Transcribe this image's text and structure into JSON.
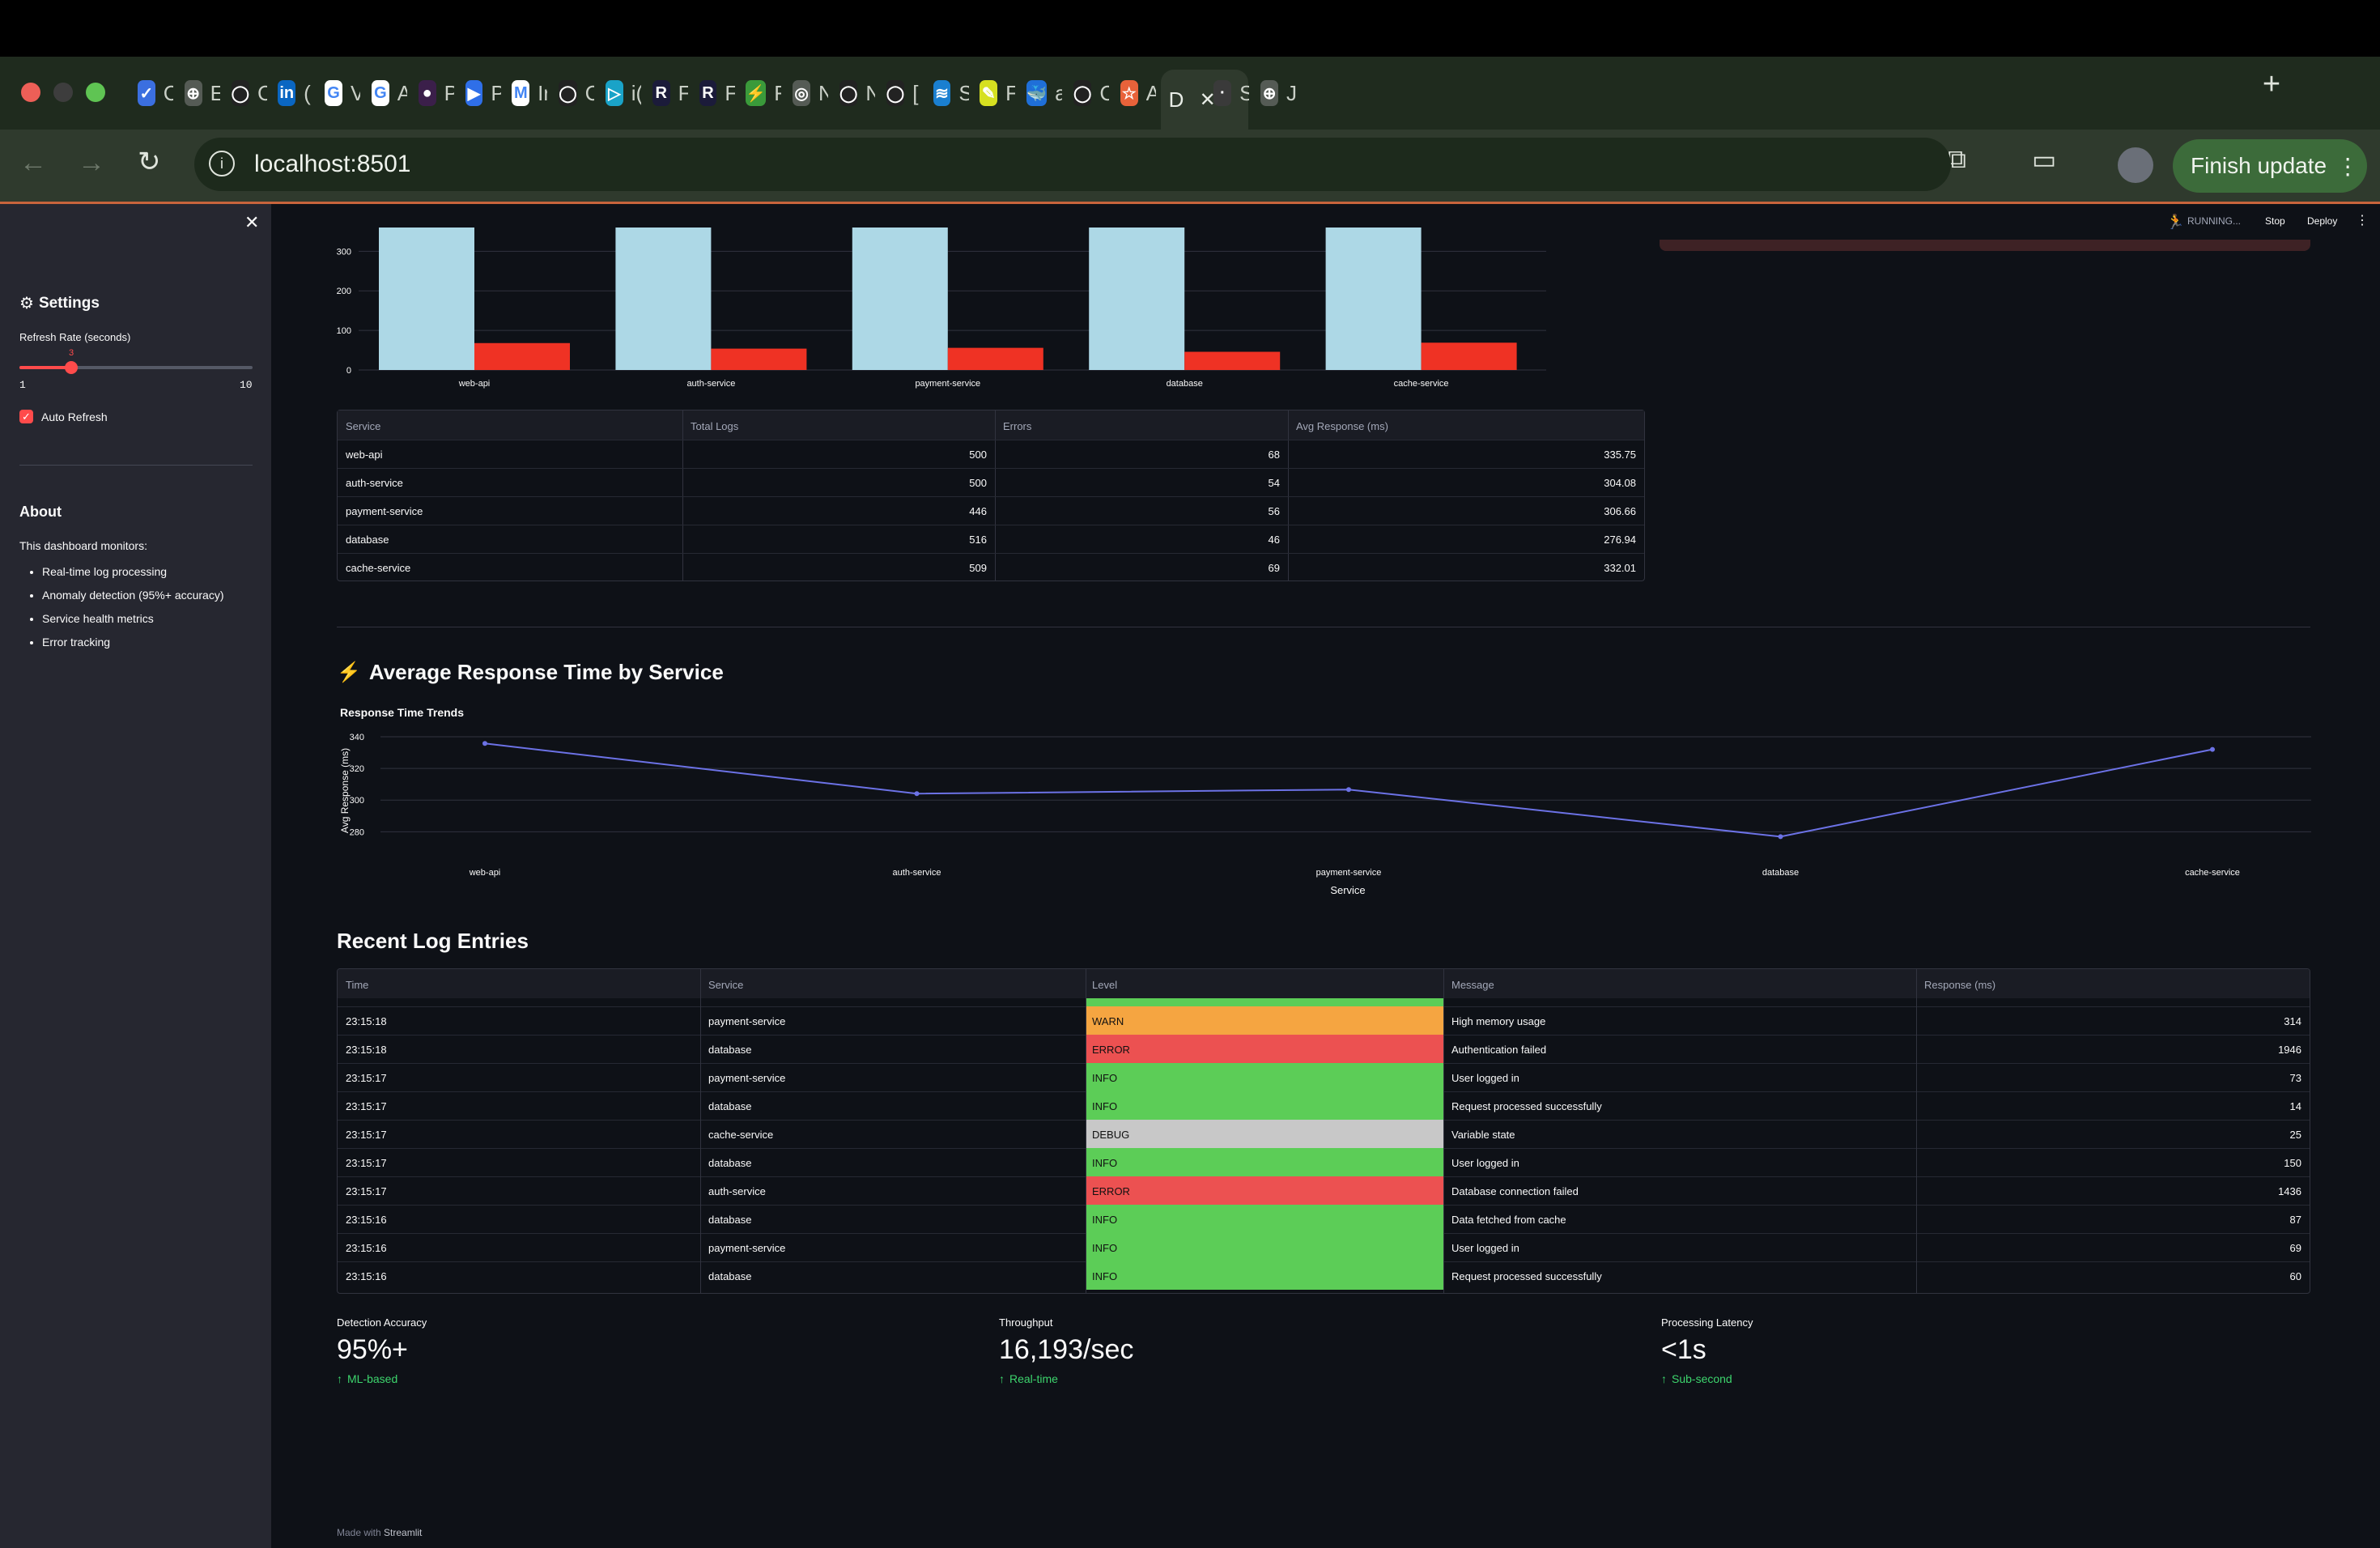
{
  "browser": {
    "tabs": [
      {
        "letter": "C",
        "color": "#3b6fe0",
        "glyph": "✓"
      },
      {
        "letter": "E",
        "color": "#555b55",
        "glyph": "⊕"
      },
      {
        "letter": "C",
        "color": "#222",
        "glyph": "◯"
      },
      {
        "letter": "(",
        "color": "#0a66c2",
        "glyph": "in"
      },
      {
        "letter": "V",
        "color": "#fff",
        "glyph": "G"
      },
      {
        "letter": "A",
        "color": "#fff",
        "glyph": "G"
      },
      {
        "letter": "P",
        "color": "#3b1f4a",
        "glyph": "●"
      },
      {
        "letter": "P",
        "color": "#2f6fe8",
        "glyph": "▶"
      },
      {
        "letter": "Ir",
        "color": "#fff",
        "glyph": "M"
      },
      {
        "letter": "C",
        "color": "#222",
        "glyph": "◯"
      },
      {
        "letter": "i(",
        "color": "#1aa3c8",
        "glyph": "▷"
      },
      {
        "letter": "F",
        "color": "#1b1b3a",
        "glyph": "R"
      },
      {
        "letter": "F",
        "color": "#1b1b3a",
        "glyph": "R"
      },
      {
        "letter": "F",
        "color": "#3a9a3a",
        "glyph": "⚡"
      },
      {
        "letter": "N",
        "color": "#555b55",
        "glyph": "◎"
      },
      {
        "letter": "N",
        "color": "#222",
        "glyph": "◯"
      },
      {
        "letter": "[",
        "color": "#222",
        "glyph": "◯"
      },
      {
        "letter": "S",
        "color": "#1a7fd0",
        "glyph": "≋"
      },
      {
        "letter": "F",
        "color": "#d6e020",
        "glyph": "✎"
      },
      {
        "letter": "a",
        "color": "#1f6fd8",
        "glyph": "🐳"
      },
      {
        "letter": "C",
        "color": "#222",
        "glyph": "◯"
      },
      {
        "letter": "A",
        "color": "#e8623a",
        "glyph": "☆"
      },
      {
        "letter": "D",
        "color": "#2f3a2d",
        "glyph": ""
      },
      {
        "letter": "S",
        "color": "#3a3a3a",
        "glyph": "·"
      },
      {
        "letter": "J",
        "color": "#555b55",
        "glyph": "⊕"
      }
    ],
    "url": "localhost:8501",
    "finish_update": "Finish update"
  },
  "app_header": {
    "status": "RUNNING...",
    "stop": "Stop",
    "deploy": "Deploy"
  },
  "sidebar": {
    "settings_title": "Settings",
    "refresh_label": "Refresh Rate (seconds)",
    "slider_value": "3",
    "slider_min": "1",
    "slider_max": "10",
    "slider_fraction": 0.2222,
    "auto_refresh": "Auto Refresh",
    "about_title": "About",
    "about_intro": "This dashboard monitors:",
    "about_items": [
      "Real-time log processing",
      "Anomaly detection (95%+ accuracy)",
      "Service health metrics",
      "Error tracking"
    ]
  },
  "service_table": {
    "headers": [
      "Service",
      "Total Logs",
      "Errors",
      "Avg Response (ms)"
    ],
    "rows": [
      [
        "web-api",
        "500",
        "68",
        "335.75"
      ],
      [
        "auth-service",
        "500",
        "54",
        "304.08"
      ],
      [
        "payment-service",
        "446",
        "56",
        "306.66"
      ],
      [
        "database",
        "516",
        "46",
        "276.94"
      ],
      [
        "cache-service",
        "509",
        "69",
        "332.01"
      ]
    ]
  },
  "response_section": {
    "icon": "⚡",
    "title": "Average Response Time by Service"
  },
  "chart_data": [
    {
      "type": "bar",
      "categories": [
        "web-api",
        "auth-service",
        "payment-service",
        "database",
        "cache-service"
      ],
      "series": [
        {
          "values": [
            500,
            500,
            446,
            516,
            509
          ],
          "color": "#add8e6"
        },
        {
          "values": [
            68,
            54,
            56,
            46,
            69
          ],
          "color": "#ef3224"
        }
      ],
      "yticks": [
        "0",
        "100",
        "200",
        "300"
      ],
      "ylim": [
        0,
        360
      ]
    },
    {
      "type": "line",
      "title": "Response Time Trends",
      "categories": [
        "web-api",
        "auth-service",
        "payment-service",
        "database",
        "cache-service"
      ],
      "series": [
        {
          "values": [
            335.75,
            304.08,
            306.66,
            276.94,
            332.01
          ],
          "color": "#6c72e6"
        }
      ],
      "xlabel": "Service",
      "ylabel": "Avg Response (ms)",
      "yticks": [
        "280",
        "300",
        "320",
        "340"
      ],
      "ylim": [
        271,
        341
      ]
    }
  ],
  "logs": {
    "title": "Recent Log Entries",
    "headers": [
      "Time",
      "Service",
      "Level",
      "Message",
      "Response (ms)"
    ],
    "rows": [
      [
        "23:15:18",
        "payment-service",
        "WARN",
        "High memory usage",
        "314"
      ],
      [
        "23:15:18",
        "database",
        "ERROR",
        "Authentication failed",
        "1946"
      ],
      [
        "23:15:17",
        "payment-service",
        "INFO",
        "User logged in",
        "73"
      ],
      [
        "23:15:17",
        "database",
        "INFO",
        "Request processed successfully",
        "14"
      ],
      [
        "23:15:17",
        "cache-service",
        "DEBUG",
        "Variable state",
        "25"
      ],
      [
        "23:15:17",
        "database",
        "INFO",
        "User logged in",
        "150"
      ],
      [
        "23:15:17",
        "auth-service",
        "ERROR",
        "Database connection failed",
        "1436"
      ],
      [
        "23:15:16",
        "database",
        "INFO",
        "Data fetched from cache",
        "87"
      ],
      [
        "23:15:16",
        "payment-service",
        "INFO",
        "User logged in",
        "69"
      ],
      [
        "23:15:16",
        "database",
        "INFO",
        "Request processed successfully",
        "60"
      ]
    ],
    "level_colors": {
      "WARN": "#f5a541",
      "ERROR": "#ec5151",
      "INFO": "#5ccd57",
      "DEBUG": "#c8c8c8"
    }
  },
  "metrics": [
    {
      "label": "Detection Accuracy",
      "value": "95%+",
      "delta": "ML-based"
    },
    {
      "label": "Throughput",
      "value": "16,193/sec",
      "delta": "Real-time"
    },
    {
      "label": "Processing Latency",
      "value": "<1s",
      "delta": "Sub-second"
    }
  ],
  "footer": {
    "made_with": "Made with",
    "brand": "Streamlit"
  }
}
